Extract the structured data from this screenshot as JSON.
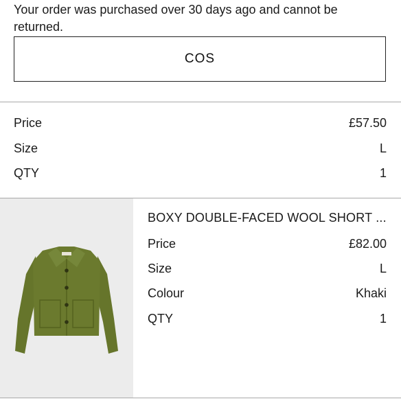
{
  "notice": "Your order was purchased over 30 days ago and cannot be returned.",
  "brand": "COS",
  "first_item": {
    "price_label": "Price",
    "price": "£57.50",
    "size_label": "Size",
    "size": "L",
    "qty_label": "QTY",
    "qty": "1"
  },
  "second_item": {
    "title": "BOXY DOUBLE-FACED WOOL SHORT ...",
    "image_icon": "khaki-wool-jacket-image",
    "price_label": "Price",
    "price": "£82.00",
    "size_label": "Size",
    "size": "L",
    "colour_label": "Colour",
    "colour": "Khaki",
    "qty_label": "QTY",
    "qty": "1"
  },
  "colors": {
    "divider": "#a8a8a8",
    "jacket": "#6b7a2e",
    "image_bg": "#ececec"
  }
}
